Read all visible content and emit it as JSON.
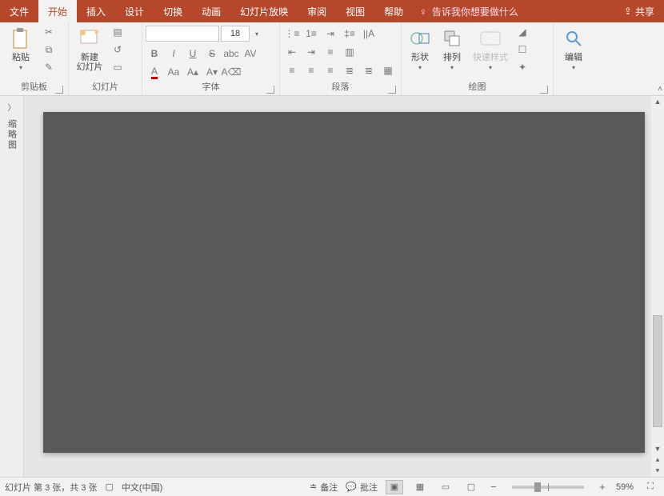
{
  "tabs": {
    "file": "文件",
    "home": "开始",
    "insert": "插入",
    "design": "设计",
    "transitions": "切换",
    "animations": "动画",
    "slideshow": "幻灯片放映",
    "review": "审阅",
    "view": "视图",
    "help": "帮助"
  },
  "tell_me": "告诉我你想要做什么",
  "share": "共享",
  "ribbon": {
    "clipboard": {
      "label": "剪贴板",
      "paste": "粘贴"
    },
    "slides": {
      "label": "幻灯片",
      "new_slide": "新建\n幻灯片"
    },
    "font": {
      "label": "字体",
      "name_placeholder": "",
      "size": "18"
    },
    "paragraph": {
      "label": "段落"
    },
    "drawing": {
      "label": "绘图",
      "shapes": "形状",
      "arrange": "排列",
      "quick_styles": "快速样式"
    },
    "editing": {
      "label": "",
      "edit": "编辑"
    }
  },
  "side_panel": {
    "thumbnails": "缩略图"
  },
  "status": {
    "slide_counter": "幻灯片 第 3 张，共 3 张",
    "language": "中文(中国)",
    "notes": "备注",
    "comments": "批注",
    "zoom_pct": "59%"
  }
}
